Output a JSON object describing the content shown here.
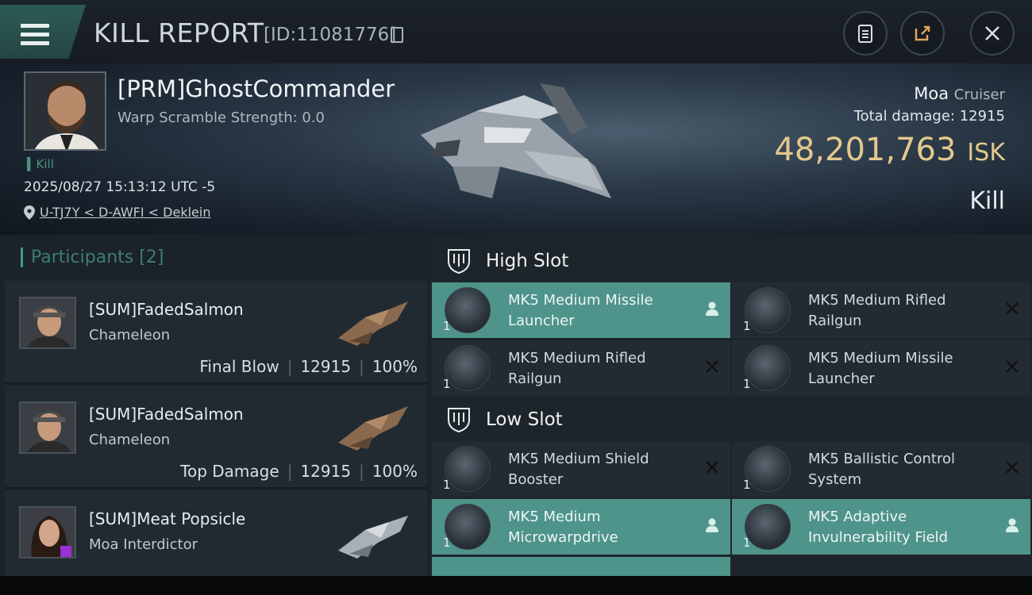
{
  "header": {
    "title": "KILL REPORT",
    "report_id": "[ID:11081776]"
  },
  "victim": {
    "name": "[PRM]GhostCommander",
    "warp_scramble": "Warp Scramble Strength: 0.0",
    "kill_tag": "Kill",
    "datetime": "2025/08/27 15:13:12 UTC -5",
    "location": "U-TJ7Y < D-AWFI < Deklein",
    "ship": "Moa",
    "ship_class": "Cruiser",
    "total_damage_label": "Total damage:",
    "total_damage": "12915",
    "isk_value": "48,201,763",
    "isk_unit": "ISK",
    "result": "Kill"
  },
  "participants": {
    "title": "Participants",
    "count": "[2]",
    "rows": [
      {
        "name": "[SUM]FadedSalmon",
        "ship": "Chameleon",
        "role": "Final Blow",
        "damage": "12915",
        "percent": "100%"
      },
      {
        "name": "[SUM]FadedSalmon",
        "ship": "Chameleon",
        "role": "Top Damage",
        "damage": "12915",
        "percent": "100%"
      },
      {
        "name": "[SUM]Meat Popsicle",
        "ship": "Moa Interdictor",
        "role": "",
        "damage": "",
        "percent": ""
      }
    ]
  },
  "slots": {
    "high_label": "High Slot",
    "low_label": "Low Slot",
    "high": [
      {
        "name": "MK5 Medium Missile Launcher",
        "qty": "1",
        "state": "active"
      },
      {
        "name": "MK5 Medium Rifled Railgun",
        "qty": "1",
        "state": "destroyed"
      },
      {
        "name": "MK5 Medium Rifled Railgun",
        "qty": "1",
        "state": "destroyed"
      },
      {
        "name": "MK5 Medium Missile Launcher",
        "qty": "1",
        "state": "destroyed"
      }
    ],
    "low": [
      {
        "name": "MK5 Medium Shield Booster",
        "qty": "1",
        "state": "destroyed"
      },
      {
        "name": "MK5 Ballistic Control System",
        "qty": "1",
        "state": "destroyed"
      },
      {
        "name": "MK5 Medium Microwarpdrive",
        "qty": "1",
        "state": "active"
      },
      {
        "name": "MK5 Adaptive Invulnerability Field",
        "qty": "1",
        "state": "active"
      }
    ]
  },
  "colors": {
    "accent_teal": "#4e948b",
    "isk_gold": "#e4c98c"
  },
  "icons": [
    "menu-icon",
    "copy-icon",
    "clipboard-icon",
    "share-icon",
    "close-icon",
    "location-pin-icon",
    "shield-slot-icon",
    "person-icon",
    "x-icon"
  ]
}
